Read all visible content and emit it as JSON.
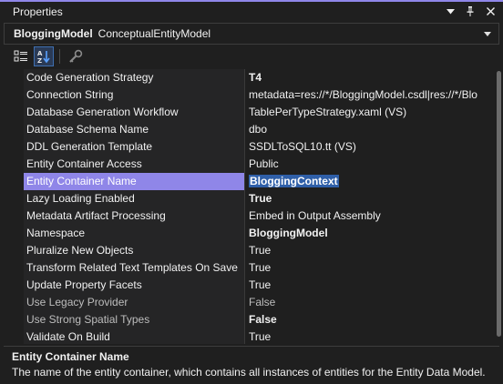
{
  "window": {
    "title": "Properties",
    "controls": [
      "chevron-down-icon",
      "pin-icon",
      "close-icon"
    ]
  },
  "object_selector": {
    "name": "BloggingModel",
    "type": "ConceptualEntityModel"
  },
  "toolbar": {
    "buttons": [
      "categorized-icon",
      "alphabetical-icon",
      "property-pages-icon"
    ],
    "active": "alphabetical-icon"
  },
  "properties": [
    {
      "name": "Code Generation Strategy",
      "value": "T4",
      "bold": true
    },
    {
      "name": "Connection String",
      "value": "metadata=res://*/BloggingModel.csdl|res://*/Blo"
    },
    {
      "name": "Database Generation Workflow",
      "value": "TablePerTypeStrategy.xaml (VS)"
    },
    {
      "name": "Database Schema Name",
      "value": "dbo"
    },
    {
      "name": "DDL Generation Template",
      "value": "SSDLToSQL10.tt (VS)"
    },
    {
      "name": "Entity Container Access",
      "value": "Public"
    },
    {
      "name": "Entity Container Name",
      "value": "BloggingContext",
      "selected": true,
      "bold": true
    },
    {
      "name": "Lazy Loading Enabled",
      "value": "True",
      "bold": true
    },
    {
      "name": "Metadata Artifact Processing",
      "value": "Embed in Output Assembly"
    },
    {
      "name": "Namespace",
      "value": "BloggingModel",
      "bold": true
    },
    {
      "name": "Pluralize New Objects",
      "value": "True"
    },
    {
      "name": "Transform Related Text Templates On Save",
      "value": "True"
    },
    {
      "name": "Update Property Facets",
      "value": "True"
    },
    {
      "name": "Use Legacy Provider",
      "value": "False",
      "muted": true
    },
    {
      "name": "Use Strong Spatial Types",
      "value": "False",
      "bold": true,
      "muted_name": true
    },
    {
      "name": "Validate On Build",
      "value": "True"
    }
  ],
  "description": {
    "title": "Entity Container Name",
    "text": "The name of the entity container, which contains all instances of entities for the Entity Data Model."
  },
  "colors": {
    "accent": "#8f86e8",
    "selection_highlight": "#2f5fa8",
    "background": "#1f1f1f"
  }
}
